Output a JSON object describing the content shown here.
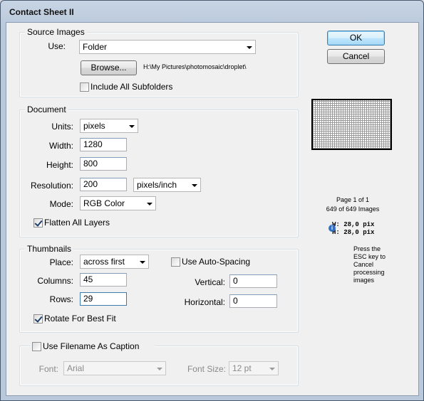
{
  "window": {
    "title": "Contact Sheet II"
  },
  "buttons": {
    "ok": "OK",
    "cancel": "Cancel",
    "browse": "Browse..."
  },
  "source_images": {
    "section_label": "Source Images",
    "use_label": "Use:",
    "use_value": "Folder",
    "folder_path": "H:\\My Pictures\\photomosaic\\droplet\\",
    "include_subfolders_label": "Include All Subfolders",
    "include_subfolders_checked": false
  },
  "document": {
    "section_label": "Document",
    "units_label": "Units:",
    "units_value": "pixels",
    "width_label": "Width:",
    "width_value": "1280",
    "height_label": "Height:",
    "height_value": "800",
    "resolution_label": "Resolution:",
    "resolution_value": "200",
    "resolution_unit": "pixels/inch",
    "mode_label": "Mode:",
    "mode_value": "RGB Color",
    "flatten_label": "Flatten All Layers",
    "flatten_checked": true
  },
  "thumbnails": {
    "section_label": "Thumbnails",
    "place_label": "Place:",
    "place_value": "across first",
    "columns_label": "Columns:",
    "columns_value": "45",
    "rows_label": "Rows:",
    "rows_value": "29",
    "rotate_label": "Rotate For Best Fit",
    "rotate_checked": true,
    "auto_spacing_label": "Use Auto-Spacing",
    "auto_spacing_checked": false,
    "vertical_label": "Vertical:",
    "vertical_value": "0",
    "horizontal_label": "Horizontal:",
    "horizontal_value": "0"
  },
  "caption": {
    "checkbox_label": "Use Filename As Caption",
    "checked": false,
    "font_label": "Font:",
    "font_value": "Arial",
    "font_size_label": "Font Size:",
    "font_size_value": "12 pt"
  },
  "preview_info": {
    "page_line": "Page 1 of 1",
    "images_line": "649 of 649 Images",
    "width_line": "W: 28,0 pix",
    "height_line": "H: 28,0 pix",
    "esc_lines": [
      "Press the",
      "ESC key to",
      "Cancel",
      "processing",
      "images"
    ]
  }
}
